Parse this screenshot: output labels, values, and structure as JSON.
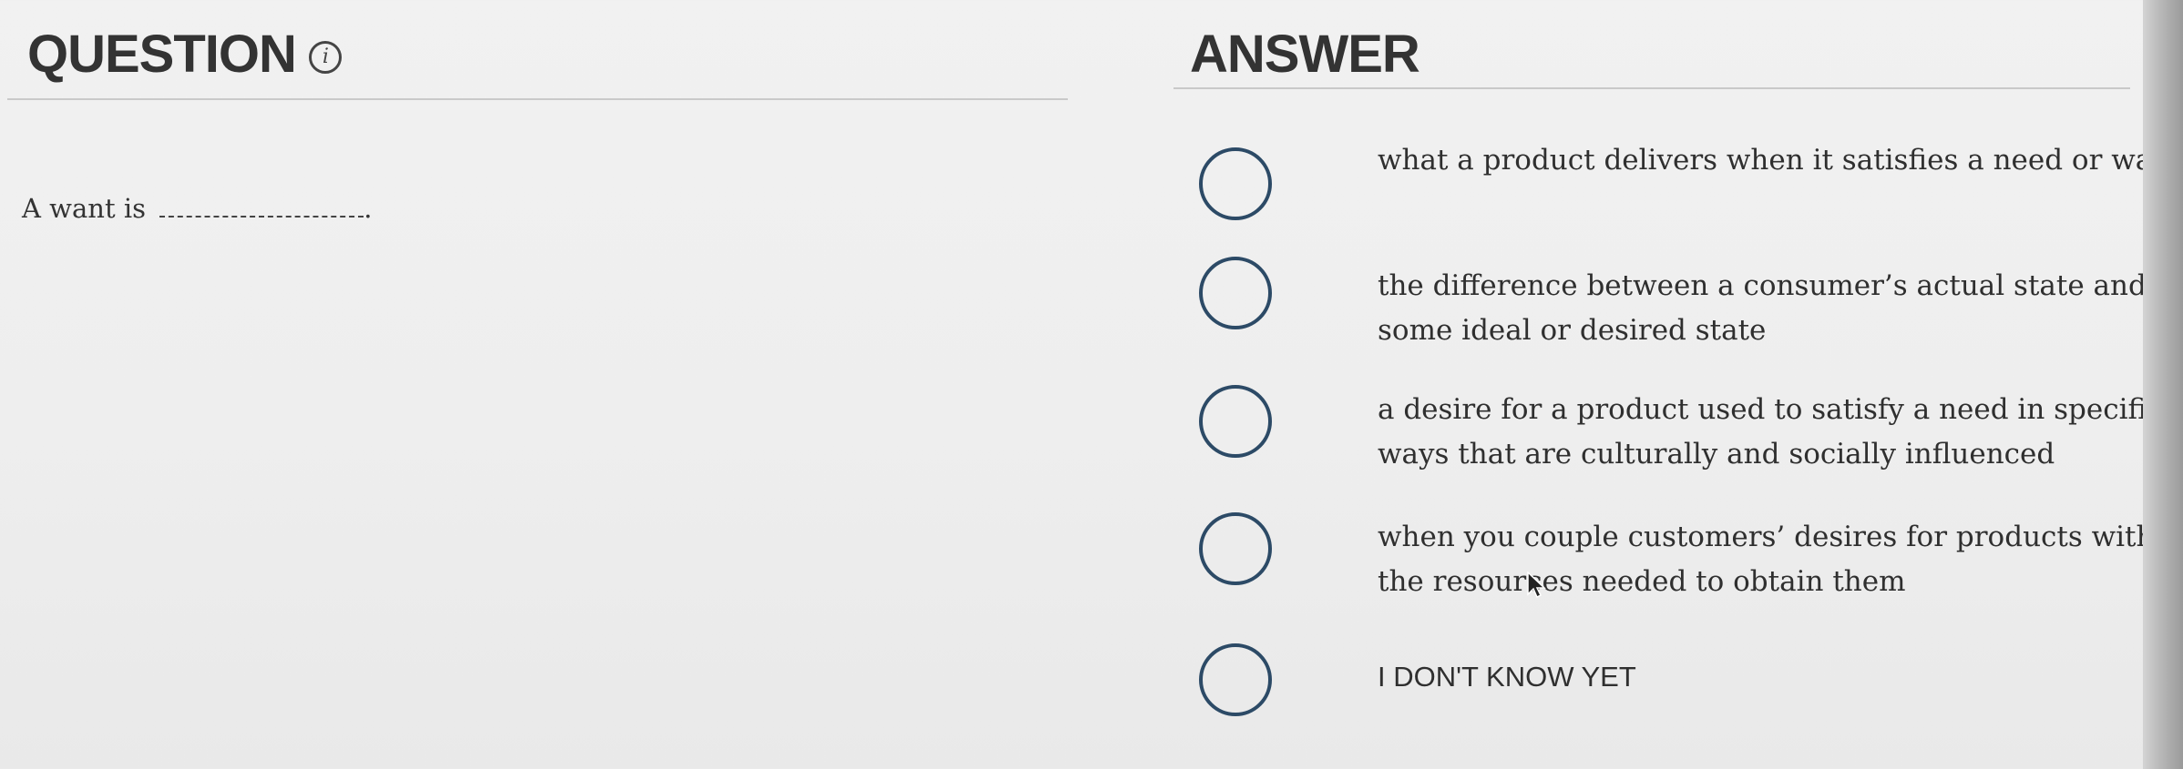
{
  "question": {
    "heading": "QUESTION",
    "info_icon": "info-circle-icon",
    "stem_prefix": "A want is",
    "stem_suffix": "."
  },
  "answer": {
    "heading": "ANSWER",
    "options": [
      {
        "label": "what a product delivers when it satisfies a need or want"
      },
      {
        "label": "the difference between a consumer’s actual state and some ideal or desired state"
      },
      {
        "label": "a desire for a product used to satisfy a need in specific ways that are culturally and socially influenced"
      },
      {
        "label": "when you couple customers’ desires for products with the resources needed to obtain them"
      },
      {
        "label": "I DON'T KNOW YET"
      }
    ]
  },
  "icons": {
    "radio": "radio-unselected-icon",
    "cursor": "mouse-pointer-icon"
  },
  "colors": {
    "radio_border": "#2c4a66",
    "text": "#2f2f2f",
    "heading": "#333333",
    "background": "#eeeeee"
  }
}
